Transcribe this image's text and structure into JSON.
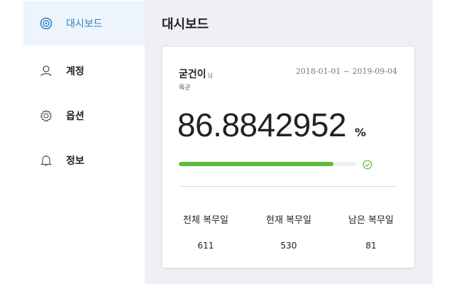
{
  "sidebar": {
    "items": [
      {
        "label": "대시보드",
        "icon": "dashboard-icon",
        "active": true
      },
      {
        "label": "계정",
        "icon": "user-icon",
        "active": false
      },
      {
        "label": "옵션",
        "icon": "gear-icon",
        "active": false
      },
      {
        "label": "정보",
        "icon": "bell-icon",
        "active": false
      }
    ]
  },
  "main": {
    "title": "대시보드"
  },
  "card": {
    "name": "굳건이",
    "honorific": "님",
    "branch": "육군",
    "period": "2018-01-01 ~ 2019-09-04",
    "percent": "86.8842952",
    "percent_sign": "%",
    "progress_fraction": 0.8688,
    "stats": [
      {
        "label": "전체 복무일",
        "value": "611"
      },
      {
        "label": "현재 복무일",
        "value": "530"
      },
      {
        "label": "남은 복무일",
        "value": "81"
      }
    ]
  },
  "colors": {
    "accent": "#2f80c9",
    "progress": "#62b837",
    "background": "#eef0f4"
  }
}
